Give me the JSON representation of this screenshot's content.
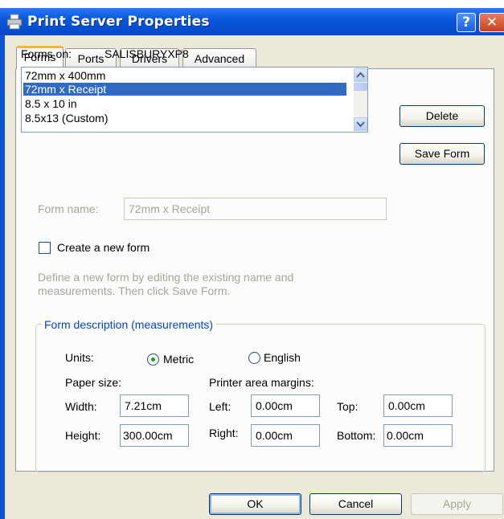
{
  "window": {
    "title": "Print Server Properties",
    "help_glyph": "?",
    "close_glyph": "✕",
    "icon": "printer-icon"
  },
  "tabs": [
    {
      "label": "Forms",
      "active": true
    },
    {
      "label": "Ports",
      "active": false
    },
    {
      "label": "Drivers",
      "active": false
    },
    {
      "label": "Advanced",
      "active": false
    }
  ],
  "forms_on": {
    "label": "Forms on:",
    "server": "SALISBURYXP8"
  },
  "forms_list": {
    "items": [
      "72mm x 400mm",
      "72mm x Receipt",
      "8.5 x 10 in",
      "8.5x13 (Custom)"
    ],
    "selected_index": 1
  },
  "buttons": {
    "delete": "Delete",
    "save_form": "Save Form",
    "ok": "OK",
    "cancel": "Cancel",
    "apply": "Apply"
  },
  "form_name": {
    "label": "Form name:",
    "value": "72mm x Receipt"
  },
  "create_new": {
    "label": "Create a new form",
    "checked": false
  },
  "hint": {
    "line1": "Define a new form by editing the existing name and",
    "line2": "measurements.  Then click Save Form."
  },
  "description": {
    "title": "Form description (measurements)",
    "units_label": "Units:",
    "metric": "Metric",
    "english": "English",
    "selected_unit": "Metric",
    "paper_size_label": "Paper size:",
    "margins_label": "Printer area margins:",
    "width_label": "Width:",
    "width_value": "7.21cm",
    "height_label": "Height:",
    "height_value": "300.00cm",
    "left_label": "Left:",
    "left_value": "0.00cm",
    "right_label": "Right:",
    "right_value": "0.00cm",
    "top_label": "Top:",
    "top_value": "0.00cm",
    "bottom_label": "Bottom:",
    "bottom_value": "0.00cm"
  },
  "colors": {
    "titlebar": "#0a58dc",
    "dialog_bg": "#ece9d8",
    "selection": "#316ac5",
    "active_tab_accent": "#f8b42a"
  }
}
